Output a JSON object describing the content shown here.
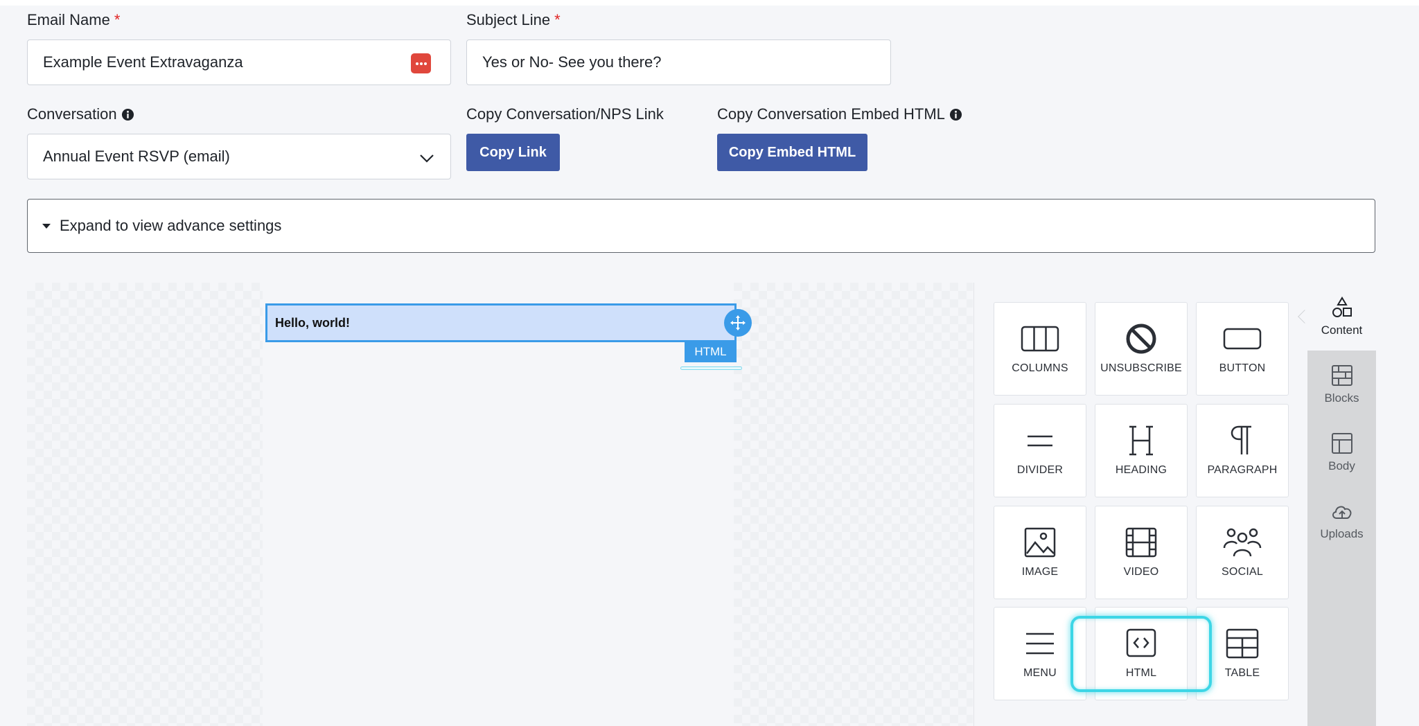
{
  "form": {
    "email_name": {
      "label": "Email Name",
      "required_mark": "*",
      "value": "Example Event Extravaganza",
      "icon": "password-dots-icon"
    },
    "subject_line": {
      "label": "Subject Line",
      "required_mark": "*",
      "value": "Yes or No- See you there?"
    },
    "conversation": {
      "label": "Conversation",
      "info_icon": "info-icon",
      "selected": "Annual Event RSVP (email)"
    },
    "copy_link": {
      "label": "Copy Conversation/NPS Link",
      "button": "Copy Link"
    },
    "copy_embed": {
      "label": "Copy Conversation Embed HTML",
      "button": "Copy Embed HTML"
    },
    "advance_settings": "Expand to view advance settings"
  },
  "canvas": {
    "html_block_text": "Hello, world!",
    "block_tag": "HTML"
  },
  "tools": {
    "tiles": [
      {
        "label": "COLUMNS",
        "icon": "columns-icon"
      },
      {
        "label": "UNSUBSCRIBE",
        "icon": "unsubscribe-icon"
      },
      {
        "label": "BUTTON",
        "icon": "button-icon"
      },
      {
        "label": "DIVIDER",
        "icon": "divider-icon"
      },
      {
        "label": "HEADING",
        "icon": "heading-icon"
      },
      {
        "label": "PARAGRAPH",
        "icon": "paragraph-icon"
      },
      {
        "label": "IMAGE",
        "icon": "image-icon"
      },
      {
        "label": "VIDEO",
        "icon": "video-icon"
      },
      {
        "label": "SOCIAL",
        "icon": "social-icon"
      },
      {
        "label": "MENU",
        "icon": "menu-icon"
      },
      {
        "label": "HTML",
        "icon": "html-code-icon"
      },
      {
        "label": "TABLE",
        "icon": "table-icon"
      }
    ],
    "side_tabs": [
      {
        "label": "Content",
        "icon": "shapes-icon",
        "active": true
      },
      {
        "label": "Blocks",
        "icon": "blocks-icon"
      },
      {
        "label": "Body",
        "icon": "body-layout-icon"
      },
      {
        "label": "Uploads",
        "icon": "cloud-upload-icon"
      }
    ]
  },
  "colors": {
    "primary_button": "#3f5aa6",
    "selection_blue": "#3a9be8",
    "highlight_cyan": "#3dd6e6",
    "required_red": "#e02424"
  }
}
